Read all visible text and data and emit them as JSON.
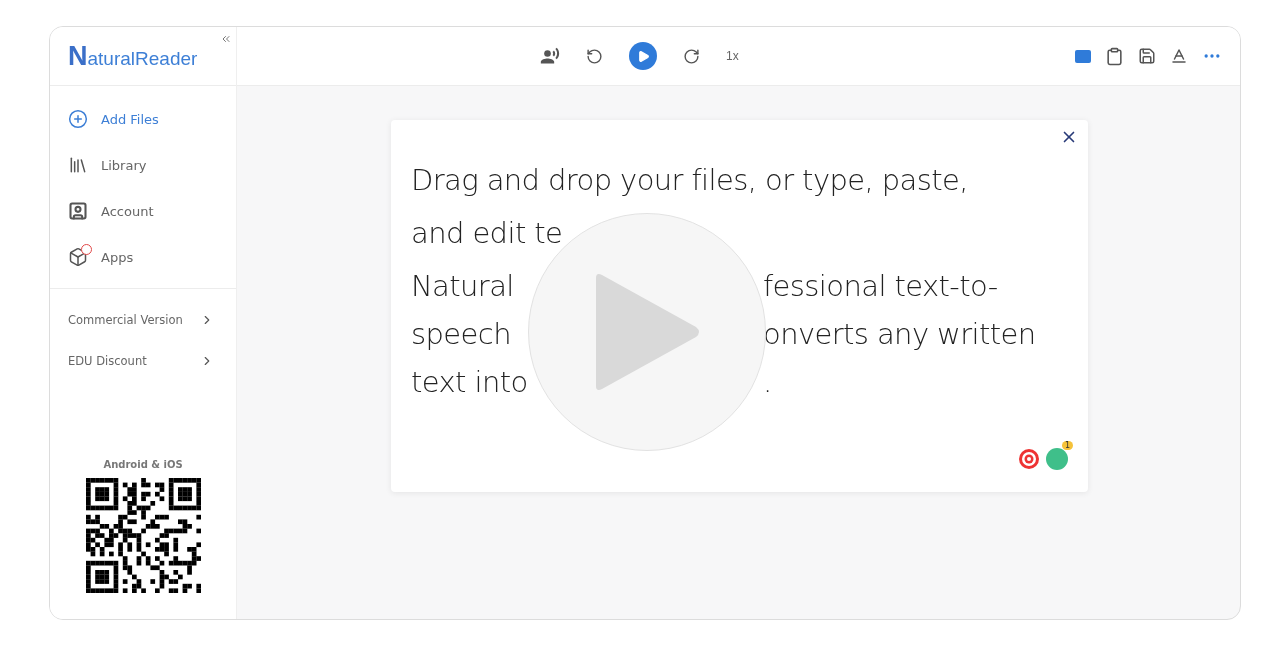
{
  "sidebar": {
    "logo": "NaturalReader",
    "items": [
      {
        "label": "Add Files",
        "kind": "primary"
      },
      {
        "label": "Library",
        "kind": "nav"
      },
      {
        "label": "Account",
        "kind": "nav"
      },
      {
        "label": "Apps",
        "kind": "nav"
      }
    ],
    "links": [
      "Commercial Version",
      "EDU Discount"
    ],
    "qr_caption": "Android & iOS"
  },
  "toolbar": {
    "speed": "1x"
  },
  "card": {
    "lines": [
      {
        "left": "Drag and drop your files, or type, paste,"
      },
      {
        "left": "and edit te"
      },
      {
        "left": "Natural",
        "right": "fessional text-to-"
      },
      {
        "left": "speech",
        "right": "onverts any written"
      },
      {
        "left": "text into",
        "right": "."
      }
    ],
    "extension_badge": "1"
  }
}
